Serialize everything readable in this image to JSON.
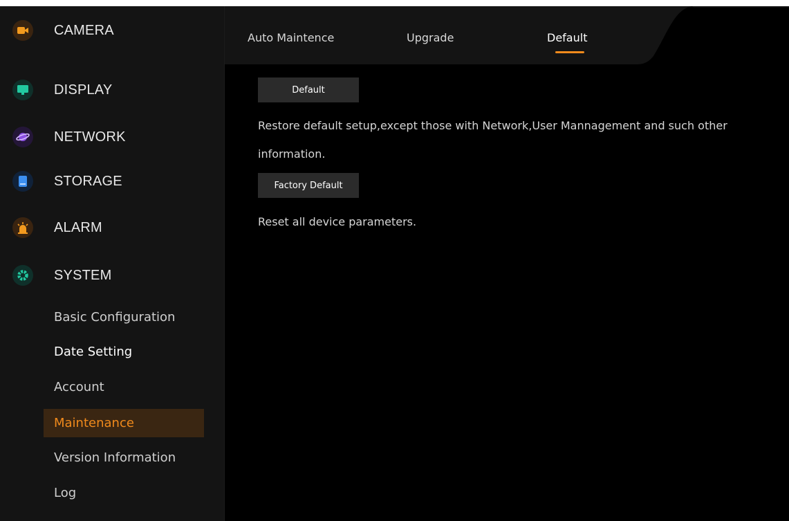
{
  "sidebar": {
    "categories": [
      {
        "label": "CAMERA",
        "icon": "camera-icon",
        "color": "#f39a1e"
      },
      {
        "label": "DISPLAY",
        "icon": "monitor-icon",
        "color": "#22c8a0"
      },
      {
        "label": "NETWORK",
        "icon": "planet-icon",
        "color": "#8a4fe0"
      },
      {
        "label": "STORAGE",
        "icon": "storage-icon",
        "color": "#3c8ff0"
      },
      {
        "label": "ALARM",
        "icon": "alarm-icon",
        "color": "#f39a1e"
      },
      {
        "label": "SYSTEM",
        "icon": "gear-icon",
        "color": "#22c8a0"
      }
    ],
    "system_items": [
      {
        "label": "Basic Configuration"
      },
      {
        "label": "Date Setting"
      },
      {
        "label": "Account"
      },
      {
        "label": "Maintenance"
      },
      {
        "label": "Version Information"
      },
      {
        "label": "Log"
      }
    ]
  },
  "tabs": [
    {
      "label": "Auto Maintence"
    },
    {
      "label": "Upgrade"
    },
    {
      "label": "Default"
    }
  ],
  "active_tab": "Default",
  "active_system_item": "Maintenance",
  "main": {
    "default_button": "Default",
    "default_desc_line1": "Restore default setup,except those with Network,User Mannagement and such other",
    "default_desc_line2": "information.",
    "factory_button": "Factory Default",
    "factory_desc": "Reset all device parameters."
  },
  "colors": {
    "accent": "#f08a1c",
    "background": "#000000",
    "sidebar": "#141414"
  }
}
